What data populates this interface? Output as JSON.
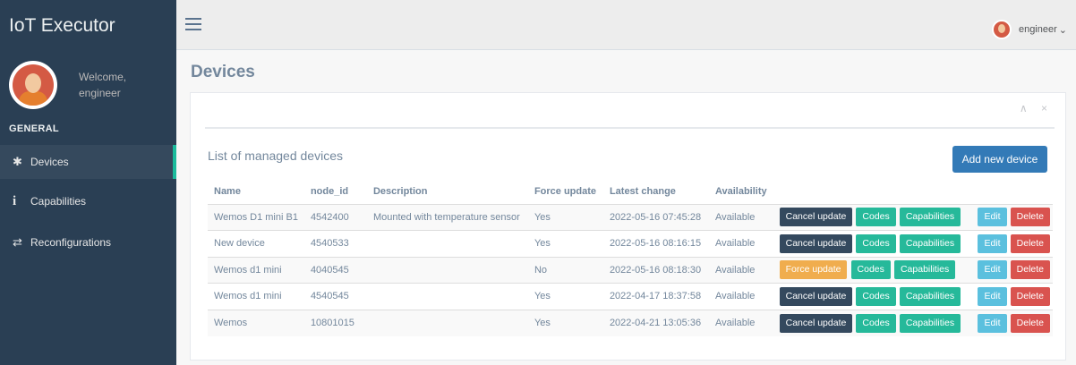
{
  "app": {
    "title": "IoT Executor"
  },
  "sidebar": {
    "welcome": "Welcome,",
    "username": "engineer",
    "section": "GENERAL",
    "items": [
      {
        "label": "Devices",
        "icon": "gear-icon",
        "active": true
      },
      {
        "label": "Capabilities",
        "icon": "info-icon"
      },
      {
        "label": "Reconfigurations",
        "icon": "arrows-exchange-icon"
      }
    ]
  },
  "topbar": {
    "user": "engineer",
    "caret": "⌄"
  },
  "page": {
    "title": "Devices"
  },
  "panel": {
    "tools": "∧ ×",
    "list_title": "List of managed devices",
    "add_button": "Add new device"
  },
  "table": {
    "headers": [
      "Name",
      "node_id",
      "Description",
      "Force update",
      "Latest change",
      "Availability"
    ],
    "rows": [
      {
        "name": "Wemos D1 mini B1",
        "node_id": "4542400",
        "description": "Mounted with temperature sensor",
        "force": "Yes",
        "changed": "2022-05-16 07:45:28",
        "availability": "Available",
        "update_label": "Cancel update",
        "update_style": "dark"
      },
      {
        "name": "New device",
        "node_id": "4540533",
        "description": "",
        "force": "Yes",
        "changed": "2022-05-16 08:16:15",
        "availability": "Available",
        "update_label": "Cancel update",
        "update_style": "dark"
      },
      {
        "name": "Wemos d1 mini",
        "node_id": "4040545",
        "description": "",
        "force": "No",
        "changed": "2022-05-16 08:18:30",
        "availability": "Available",
        "update_label": "Force update",
        "update_style": "warn"
      },
      {
        "name": "Wemos d1 mini",
        "node_id": "4540545",
        "description": "",
        "force": "Yes",
        "changed": "2022-04-17 18:37:58",
        "availability": "Available",
        "update_label": "Cancel update",
        "update_style": "dark"
      },
      {
        "name": "Wemos",
        "node_id": "10801015",
        "description": "",
        "force": "Yes",
        "changed": "2022-04-21 13:05:36",
        "availability": "Available",
        "update_label": "Cancel update",
        "update_style": "dark"
      }
    ],
    "codes_label": "Codes",
    "capabilities_label": "Capabilities",
    "edit_label": "Edit",
    "delete_label": "Delete"
  },
  "colors": {
    "sidebar": "#2A3F54",
    "accent": "#1ABB9C",
    "primary": "#337AB7",
    "danger": "#D9534F",
    "warning": "#F0AD4E",
    "info": "#5BC0DE",
    "dark": "#34495E"
  }
}
